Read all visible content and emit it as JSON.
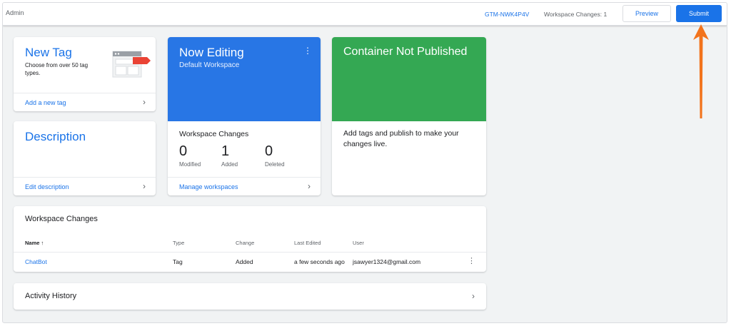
{
  "header": {
    "admin": "Admin",
    "container_id": "GTM-NWK4P4V",
    "workspace_changes": "Workspace Changes: 1",
    "preview_label": "Preview",
    "submit_label": "Submit"
  },
  "new_tag": {
    "title": "New Tag",
    "description": "Choose from over 50 tag types.",
    "link": "Add a new tag",
    "chevron": "›"
  },
  "description_card": {
    "title": "Description",
    "link": "Edit description",
    "chevron": "›"
  },
  "now_editing": {
    "title": "Now Editing",
    "workspace": "Default Workspace",
    "menu": "⋮",
    "changes_title": "Workspace Changes",
    "stats": [
      {
        "value": "0",
        "label": "Modified"
      },
      {
        "value": "1",
        "label": "Added"
      },
      {
        "value": "0",
        "label": "Deleted"
      }
    ],
    "link": "Manage workspaces",
    "chevron": "›"
  },
  "container": {
    "title": "Container Not Published",
    "text": "Add tags and publish to make your changes live."
  },
  "workspace_changes": {
    "title": "Workspace Changes",
    "columns": [
      "Name ↑",
      "Type",
      "Change",
      "Last Edited",
      "User"
    ],
    "rows": [
      {
        "name": "ChatBot",
        "type": "Tag",
        "change": "Added",
        "last_edited": "a few seconds ago",
        "user": "jsawyer1324@gmail.com",
        "menu": "⋮"
      }
    ]
  },
  "activity": {
    "title": "Activity History",
    "chevron": "›"
  },
  "colors": {
    "primary": "#1a73e8",
    "now_editing_bg": "#2876e5",
    "not_published_bg": "#34a853",
    "annotation_arrow": "#f2731c"
  }
}
